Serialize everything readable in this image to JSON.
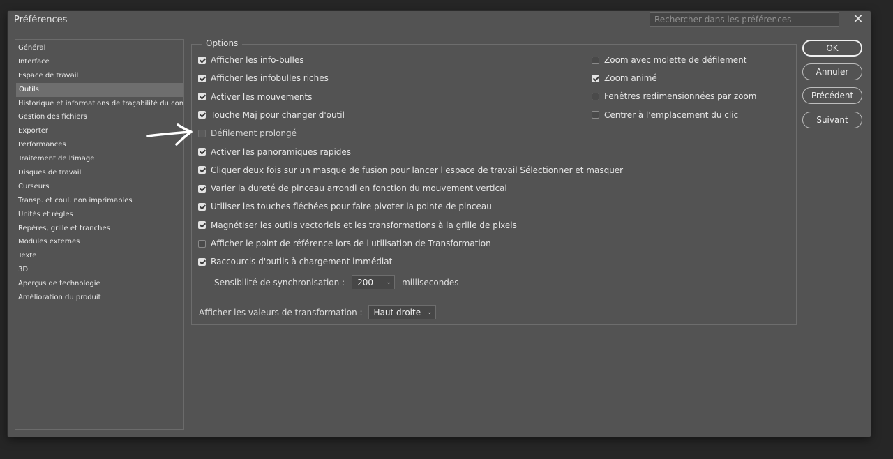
{
  "window": {
    "title": "Préférences",
    "search_placeholder": "Rechercher dans les préférences",
    "close_glyph": "✕"
  },
  "sidebar": {
    "items": [
      {
        "label": "Général",
        "selected": false
      },
      {
        "label": "Interface",
        "selected": false
      },
      {
        "label": "Espace de travail",
        "selected": false
      },
      {
        "label": "Outils",
        "selected": true
      },
      {
        "label": "Historique et informations de traçabilité du contenu",
        "selected": false
      },
      {
        "label": "Gestion des fichiers",
        "selected": false
      },
      {
        "label": "Exporter",
        "selected": false
      },
      {
        "label": "Performances",
        "selected": false
      },
      {
        "label": "Traitement de l'image",
        "selected": false
      },
      {
        "label": "Disques de travail",
        "selected": false
      },
      {
        "label": "Curseurs",
        "selected": false
      },
      {
        "label": "Transp. et coul. non imprimables",
        "selected": false
      },
      {
        "label": "Unités et règles",
        "selected": false
      },
      {
        "label": "Repères, grille et tranches",
        "selected": false
      },
      {
        "label": "Modules externes",
        "selected": false
      },
      {
        "label": "Texte",
        "selected": false
      },
      {
        "label": "3D",
        "selected": false
      },
      {
        "label": "Aperçus de technologie",
        "selected": false
      },
      {
        "label": "Amélioration du produit",
        "selected": false
      }
    ]
  },
  "options": {
    "legend": "Options",
    "left": [
      {
        "label": "Afficher les info-bulles",
        "checked": true
      },
      {
        "label": "Afficher les infobulles riches",
        "checked": true
      },
      {
        "label": "Activer les mouvements",
        "checked": true
      },
      {
        "label": "Touche Maj pour changer d'outil",
        "checked": true
      },
      {
        "label": "Défilement prolongé",
        "checked": false,
        "disabled": true
      },
      {
        "label": "Activer les panoramiques rapides",
        "checked": true
      },
      {
        "label": "Cliquer deux fois sur un masque de fusion pour lancer l'espace de travail Sélectionner et masquer",
        "checked": true
      },
      {
        "label": "Varier la dureté de pinceau arrondi en fonction du mouvement vertical",
        "checked": true
      },
      {
        "label": "Utiliser les touches fléchées pour faire pivoter la pointe de pinceau",
        "checked": true
      },
      {
        "label": "Magnétiser les outils vectoriels et les transformations à la grille de pixels",
        "checked": true
      },
      {
        "label": "Afficher le point de référence lors de l'utilisation de Transformation",
        "checked": false
      },
      {
        "label": "Raccourcis d'outils à chargement immédiat",
        "checked": true
      }
    ],
    "right": [
      {
        "label": "Zoom avec molette de défilement",
        "checked": false
      },
      {
        "label": "Zoom animé",
        "checked": true
      },
      {
        "label": "Fenêtres redimensionnées par zoom",
        "checked": false
      },
      {
        "label": "Centrer à l'emplacement du clic",
        "checked": false
      }
    ],
    "sync": {
      "label": "Sensibilité de synchronisation :",
      "value": "200",
      "unit": "millisecondes"
    },
    "transform": {
      "label": "Afficher les valeurs de transformation :",
      "value": "Haut droite"
    }
  },
  "buttons": {
    "ok": "OK",
    "cancel": "Annuler",
    "previous": "Précédent",
    "next": "Suivant"
  },
  "icons": {
    "chevron": "chevron-down-icon",
    "arrow": "hand-drawn-arrow-icon"
  }
}
